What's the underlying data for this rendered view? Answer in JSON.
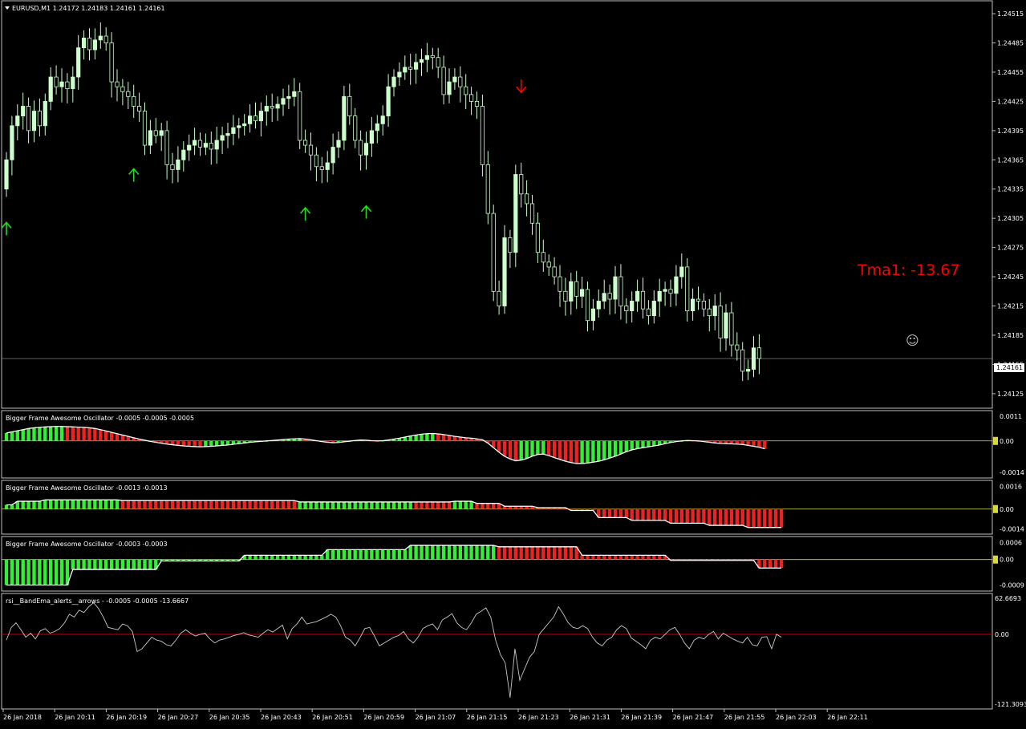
{
  "window": {
    "symbol_header": "EURUSD,M1  1.24172 1.24183 1.24161 1.24161",
    "price_tag": "1.24161",
    "tma_label": "Tma1:  -13.67",
    "smiley": "☺"
  },
  "colors": {
    "background": "#000000",
    "frame": "#c0c0c0",
    "candle_bull": "#ccffcc",
    "candle_wick": "#ccffcc",
    "arrow_up": "#22dd22",
    "arrow_down": "#ff0000",
    "bar_green": "#33ee33",
    "bar_red": "#ee2222",
    "ao_line": "#ffffff",
    "zero_line_yellow": "#d9d93a",
    "rsi_line": "#c8c8c8",
    "rsi_zero_line": "#cc0000",
    "tma_text": "#ff0000",
    "tag_bg": "#ffffff",
    "tag_text": "#000000"
  },
  "time_axis": {
    "labels": [
      "26 Jan 2018",
      "26 Jan 20:11",
      "26 Jan 20:19",
      "26 Jan 20:27",
      "26 Jan 20:35",
      "26 Jan 20:43",
      "26 Jan 20:51",
      "26 Jan 20:59",
      "26 Jan 21:07",
      "26 Jan 21:15",
      "26 Jan 21:23",
      "26 Jan 21:31",
      "26 Jan 21:39",
      "26 Jan 21:47",
      "26 Jan 21:55",
      "26 Jan 22:03",
      "26 Jan 22:11"
    ]
  },
  "chart_data": [
    {
      "type": "candlestick",
      "name": "EURUSD,M1",
      "price_axis": [
        "1.24515",
        "1.24485",
        "1.24455",
        "1.24425",
        "1.24395",
        "1.24365",
        "1.24335",
        "1.24305",
        "1.24275",
        "1.24245",
        "1.24215",
        "1.24185",
        "1.24155",
        "1.24125"
      ],
      "ylim": [
        1.24115,
        1.2452
      ],
      "current_price": 1.24161,
      "last_bar": {
        "open": 1.24172,
        "high": 1.24183,
        "low": 1.24161,
        "close": 1.24161
      },
      "closes": [
        1.24365,
        1.244,
        1.2441,
        1.2442,
        1.24395,
        1.24415,
        1.244,
        1.24425,
        1.2445,
        1.2444,
        1.24445,
        1.24438,
        1.2445,
        1.2448,
        1.2449,
        1.24478,
        1.24488,
        1.24492,
        1.24485,
        1.24445,
        1.2444,
        1.24435,
        1.2443,
        1.2442,
        1.24415,
        1.2438,
        1.24395,
        1.2439,
        1.24395,
        1.2436,
        1.24355,
        1.24365,
        1.24375,
        1.2438,
        1.24385,
        1.24378,
        1.24382,
        1.24376,
        1.24385,
        1.2439,
        1.24392,
        1.24398,
        1.244,
        1.24402,
        1.2441,
        1.24405,
        1.24415,
        1.2442,
        1.24418,
        1.24422,
        1.24428,
        1.2443,
        1.24435,
        1.24385,
        1.2438,
        1.2437,
        1.24358,
        1.24355,
        1.24362,
        1.24378,
        1.24385,
        1.2443,
        1.2441,
        1.24385,
        1.2437,
        1.24382,
        1.24395,
        1.24402,
        1.2441,
        1.2444,
        1.2445,
        1.24455,
        1.2446,
        1.24458,
        1.24465,
        1.24468,
        1.24472,
        1.2447,
        1.2446,
        1.24432,
        1.24445,
        1.2445,
        1.2444,
        1.24432,
        1.24425,
        1.2442,
        1.2436,
        1.2431,
        1.2423,
        1.24215,
        1.24285,
        1.2427,
        1.2435,
        1.2433,
        1.2432,
        1.243,
        1.2427,
        1.2426,
        1.24255,
        1.24245,
        1.2423,
        1.2422,
        1.2424,
        1.24225,
        1.24232,
        1.242,
        1.24212,
        1.2422,
        1.24228,
        1.24222,
        1.24245,
        1.24215,
        1.2421,
        1.2422,
        1.2423,
        1.24212,
        1.24205,
        1.2422,
        1.2423,
        1.24232,
        1.24228,
        1.24245,
        1.24255,
        1.2421,
        1.24222,
        1.2422,
        1.24212,
        1.24205,
        1.24215,
        1.24182,
        1.24208,
        1.24175,
        1.2417,
        1.24148,
        1.2415,
        1.24172,
        1.24161
      ],
      "signal_arrows": [
        {
          "dir": "up",
          "bar": 0
        },
        {
          "dir": "up",
          "bar": 23
        },
        {
          "dir": "up",
          "bar": 54
        },
        {
          "dir": "up",
          "bar": 65
        },
        {
          "dir": "down",
          "bar": 93
        }
      ]
    },
    {
      "type": "bar",
      "name": "Bigger Frame Awesome Oscillator",
      "title": "Bigger Frame Awesome Oscillator -0.0005 -0.0005 -0.0005",
      "axis_labels": [
        "0.0011",
        "0.00",
        "-0.0014"
      ],
      "ylim": [
        -0.0015,
        0.0012
      ],
      "values": [
        0.00035,
        0.0004,
        0.00045,
        0.0005,
        0.00055,
        0.00058,
        0.0006,
        0.00062,
        0.00063,
        0.00064,
        0.00064,
        0.00063,
        0.00062,
        0.00061,
        0.0006,
        0.00058,
        0.00055,
        0.0005,
        0.00044,
        0.00038,
        0.00032,
        0.00026,
        0.0002,
        0.00014,
        8e-05,
        3e-05,
        -2e-05,
        -6e-05,
        -0.0001,
        -0.00014,
        -0.00017,
        -0.0002,
        -0.00022,
        -0.00024,
        -0.00025,
        -0.00026,
        -0.00025,
        -0.00024,
        -0.00022,
        -0.0002,
        -0.00018,
        -0.00015,
        -0.00012,
        -9e-05,
        -6e-05,
        -4e-05,
        -2e-05,
        0.0,
        2e-05,
        4e-05,
        6e-05,
        8e-05,
        9e-05,
        0.0001,
        8e-05,
        5e-05,
        1e-05,
        -3e-05,
        -6e-05,
        -8e-05,
        -7e-05,
        -4e-05,
        -1e-05,
        2e-05,
        4e-05,
        3e-05,
        1e-05,
        0.0,
        1e-05,
        4e-05,
        8e-05,
        0.00012,
        0.00017,
        0.00022,
        0.00026,
        0.0003,
        0.00032,
        0.00033,
        0.00031,
        0.00028,
        0.00024,
        0.0002,
        0.00017,
        0.00014,
        0.00012,
        9e-05,
        5e-05,
        -0.0001,
        -0.0003,
        -0.0005,
        -0.00068,
        -0.0008,
        -0.00088,
        -0.00085,
        -0.00078,
        -0.00068,
        -0.0006,
        -0.00058,
        -0.00065,
        -0.00074,
        -0.00082,
        -0.0009,
        -0.00096,
        -0.001,
        -0.001,
        -0.00098,
        -0.00094,
        -0.0009,
        -0.00084,
        -0.00076,
        -0.00068,
        -0.00058,
        -0.00048,
        -0.0004,
        -0.00034,
        -0.0003,
        -0.00026,
        -0.00022,
        -0.00018,
        -0.00012,
        -7e-05,
        -3e-05,
        0.0,
        2e-05,
        1e-05,
        0.0,
        -3e-05,
        -6e-05,
        -9e-05,
        -0.00011,
        -0.00012,
        -0.00013,
        -0.00014,
        -0.00016,
        -0.0002,
        -0.00024,
        -0.00028,
        -0.00035
      ]
    },
    {
      "type": "bar",
      "name": "Bigger Frame Awesome Oscillator",
      "title": "Bigger Frame Awesome Oscillator -0.0013 -0.0013",
      "axis_labels": [
        "0.0016",
        "0.00",
        "-0.0014"
      ],
      "ylim": [
        -0.0016,
        0.0018
      ],
      "values": [
        0.0003,
        0.0003,
        0.0005,
        0.0005,
        0.0005,
        0.0005,
        0.0005,
        0.0006,
        0.0006,
        0.0006,
        0.0006,
        0.0006,
        0.0006,
        0.0006,
        0.0006,
        0.0006,
        0.0006,
        0.0006,
        0.0006,
        0.0006,
        0.0006,
        0.0006,
        0.0006,
        0.0006,
        0.0006,
        0.0006,
        0.0006,
        0.0006,
        0.0006,
        0.0006,
        0.0005,
        0.0005,
        0.0005,
        0.0005,
        0.0005,
        0.0005,
        0.0005,
        0.0005,
        0.0005,
        0.0005,
        0.0005,
        0.0005,
        0.0005,
        0.0005,
        0.0005,
        0.0005,
        0.0005,
        0.0005,
        0.0005,
        0.0005,
        0.0005,
        0.0005,
        0.0005,
        0.0005,
        0.0005,
        0.0005,
        0.0005,
        0.0005,
        0.0005,
        0.0005,
        0.0005,
        0.0005,
        0.0005,
        0.0005,
        0.0005,
        0.0005,
        0.0005,
        0.0005,
        0.0005,
        0.0005,
        0.0005,
        0.0005,
        0.0005,
        0.0005,
        0.0005,
        0.0005,
        0.0005,
        0.0005,
        0.0005,
        0.0005,
        0.0005,
        0.0005,
        0.0005,
        0.0005,
        0.0005,
        0.0005,
        0.0005,
        0.0005,
        0.0005,
        0.0005,
        0.0005,
        0.0005,
        0.0005,
        0.0005,
        0.0005,
        0.0005,
        0.0005,
        0.0005,
        0.0005,
        0.0005,
        0.0005,
        0.0005,
        0.0005,
        0.0005,
        0.0005,
        0.0005,
        0.0005,
        0.0005,
        0.0005,
        0.0005,
        0.0005,
        0.0005,
        0.0005,
        0.0005,
        0.0005,
        0.0005,
        0.0005,
        0.0005,
        0.0005,
        0.0005,
        0.0005,
        0.0005,
        0.0005,
        0.0005,
        0.0005,
        0.0005,
        0.0005,
        0.0005,
        0.0005,
        0.0005,
        0.0005,
        0.0005,
        0.0005,
        0.0005,
        0.0005
      ],
      "segments": [
        {
          "from": 0,
          "to": 1,
          "value": 0.0003,
          "color": "green"
        },
        {
          "from": 2,
          "to": 6,
          "value": 0.00055,
          "color": "green"
        },
        {
          "from": 7,
          "to": 20,
          "value": 0.00065,
          "color": "green"
        },
        {
          "from": 21,
          "to": 52,
          "value": 0.0006,
          "color": "red"
        },
        {
          "from": 53,
          "to": 73,
          "value": 0.0005,
          "color": "green"
        },
        {
          "from": 74,
          "to": 80,
          "value": 0.0005,
          "color": "red"
        },
        {
          "from": 81,
          "to": 84,
          "value": 0.00055,
          "color": "green"
        },
        {
          "from": 85,
          "to": 89,
          "value": 0.0004,
          "color": "red"
        },
        {
          "from": 90,
          "to": 95,
          "value": 0.0002,
          "color": "red"
        },
        {
          "from": 96,
          "to": 101,
          "value": 0.0001,
          "color": "red"
        },
        {
          "from": 102,
          "to": 106,
          "value": -0.0001,
          "color": "red"
        },
        {
          "from": 107,
          "to": 112,
          "value": -0.0006,
          "color": "red"
        },
        {
          "from": 113,
          "to": 119,
          "value": -0.0008,
          "color": "red"
        },
        {
          "from": 120,
          "to": 126,
          "value": -0.001,
          "color": "red"
        },
        {
          "from": 127,
          "to": 133,
          "value": -0.00115,
          "color": "red"
        },
        {
          "from": 134,
          "to": 140,
          "value": -0.0013,
          "color": "red"
        }
      ]
    },
    {
      "type": "bar",
      "name": "Bigger Frame Awesome Oscillator",
      "title": "Bigger Frame Awesome Oscillator -0.0003 -0.0003",
      "axis_labels": [
        "0.0006",
        "0.00",
        "-0.0009"
      ],
      "ylim": [
        -0.001,
        0.0007
      ],
      "segments": [
        {
          "from": 0,
          "to": 11,
          "value": -0.0009,
          "color": "green"
        },
        {
          "from": 12,
          "to": 27,
          "value": -0.00035,
          "color": "green"
        },
        {
          "from": 28,
          "to": 42,
          "value": -5e-05,
          "color": "green"
        },
        {
          "from": 43,
          "to": 57,
          "value": 0.00015,
          "color": "green"
        },
        {
          "from": 58,
          "to": 72,
          "value": 0.00035,
          "color": "green"
        },
        {
          "from": 73,
          "to": 88,
          "value": 0.0005,
          "color": "green"
        },
        {
          "from": 89,
          "to": 103,
          "value": 0.00045,
          "color": "red"
        },
        {
          "from": 104,
          "to": 119,
          "value": 0.00015,
          "color": "red"
        },
        {
          "from": 120,
          "to": 135,
          "value": -3e-05,
          "color": "red"
        },
        {
          "from": 136,
          "to": 140,
          "value": -0.0003,
          "color": "red"
        }
      ]
    },
    {
      "type": "line",
      "name": "rsi__BandEma_alerts__arrows",
      "title": "rsi__BandEma_alerts__arrows - -0.0005 -0.0005 -13.6667",
      "axis_labels": [
        "62.6693",
        "0.00",
        "-121.3093"
      ],
      "ylim": [
        -121.3093,
        62.6693
      ],
      "values": [
        -10,
        12,
        20,
        8,
        -5,
        2,
        -8,
        6,
        10,
        2,
        5,
        10,
        20,
        35,
        30,
        42,
        38,
        48,
        55,
        45,
        30,
        12,
        10,
        8,
        18,
        15,
        5,
        -30,
        -25,
        -15,
        -5,
        -10,
        -12,
        -18,
        -20,
        -10,
        2,
        8,
        2,
        -3,
        0,
        2,
        -8,
        -15,
        -10,
        -8,
        -5,
        -2,
        0,
        3,
        -1,
        -3,
        -5,
        2,
        8,
        4,
        10,
        16,
        -8,
        10,
        18,
        30,
        18,
        20,
        22,
        26,
        30,
        35,
        30,
        15,
        -5,
        -10,
        -20,
        -6,
        10,
        12,
        -3,
        -20,
        -15,
        -10,
        -5,
        -2,
        5,
        -8,
        -15,
        -5,
        10,
        15,
        18,
        8,
        25,
        30,
        36,
        20,
        12,
        8,
        20,
        35,
        40,
        46,
        30,
        -10,
        -35,
        -50,
        -110,
        -25,
        -80,
        -60,
        -40,
        -30,
        0,
        10,
        20,
        30,
        48,
        35,
        20,
        12,
        10,
        15,
        10,
        -5,
        -15,
        -20,
        -10,
        -5,
        8,
        15,
        10,
        -6,
        -12,
        -18,
        -25,
        -10,
        -5,
        -8,
        0,
        8,
        12,
        0,
        -15,
        -25,
        -10,
        -5,
        -8,
        0,
        5,
        -8,
        2,
        -3,
        -8,
        -12,
        -15,
        -5,
        -18,
        -20,
        -5,
        -4,
        -25,
        0,
        -5
      ]
    }
  ]
}
